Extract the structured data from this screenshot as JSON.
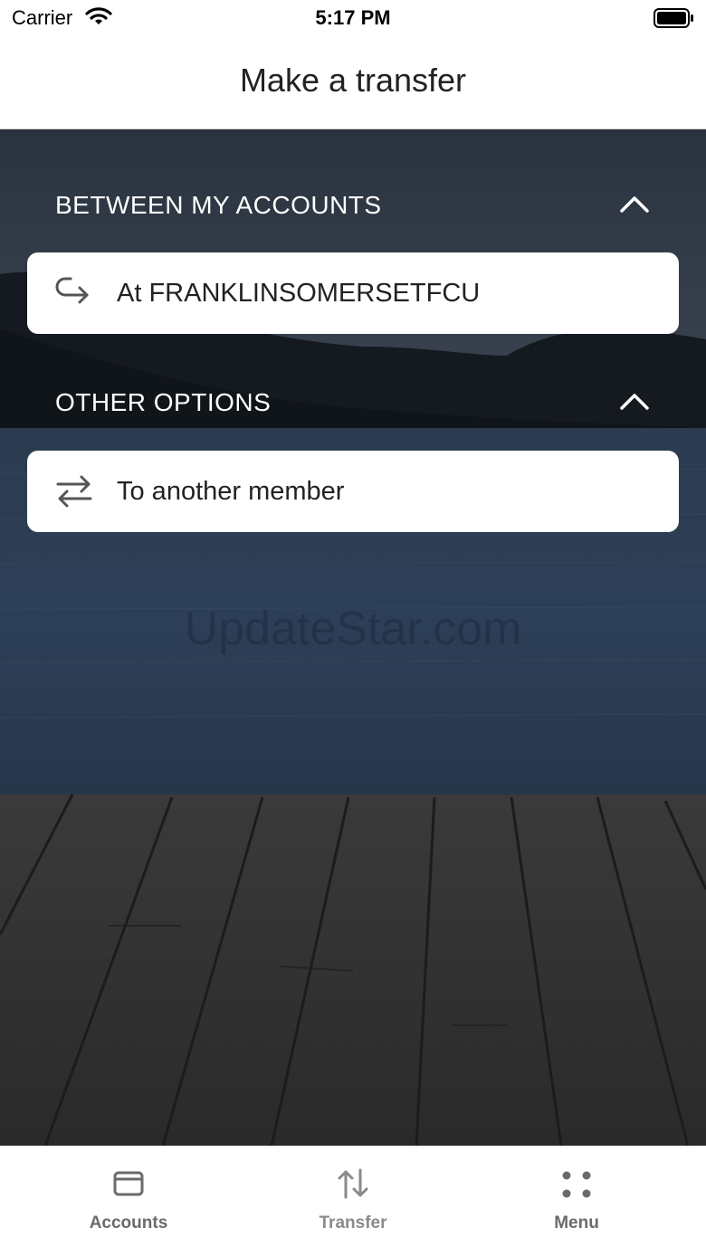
{
  "status_bar": {
    "carrier": "Carrier",
    "time": "5:17 PM"
  },
  "header": {
    "title": "Make a transfer"
  },
  "watermark": "UpdateStar.com",
  "sections": [
    {
      "title": "BETWEEN MY ACCOUNTS",
      "items": [
        {
          "label": "At FRANKLINSOMERSETFCU",
          "icon": "internal-transfer-icon"
        }
      ]
    },
    {
      "title": "OTHER OPTIONS",
      "items": [
        {
          "label": "To another member",
          "icon": "swap-arrows-icon"
        }
      ]
    }
  ],
  "tabs": [
    {
      "label": "Accounts",
      "icon": "wallet-icon",
      "color": "#6b6b6b"
    },
    {
      "label": "Transfer",
      "icon": "transfer-arrows-icon",
      "color": "#8a8a8a"
    },
    {
      "label": "Menu",
      "icon": "grid-dots-icon",
      "color": "#6b6b6b"
    }
  ]
}
